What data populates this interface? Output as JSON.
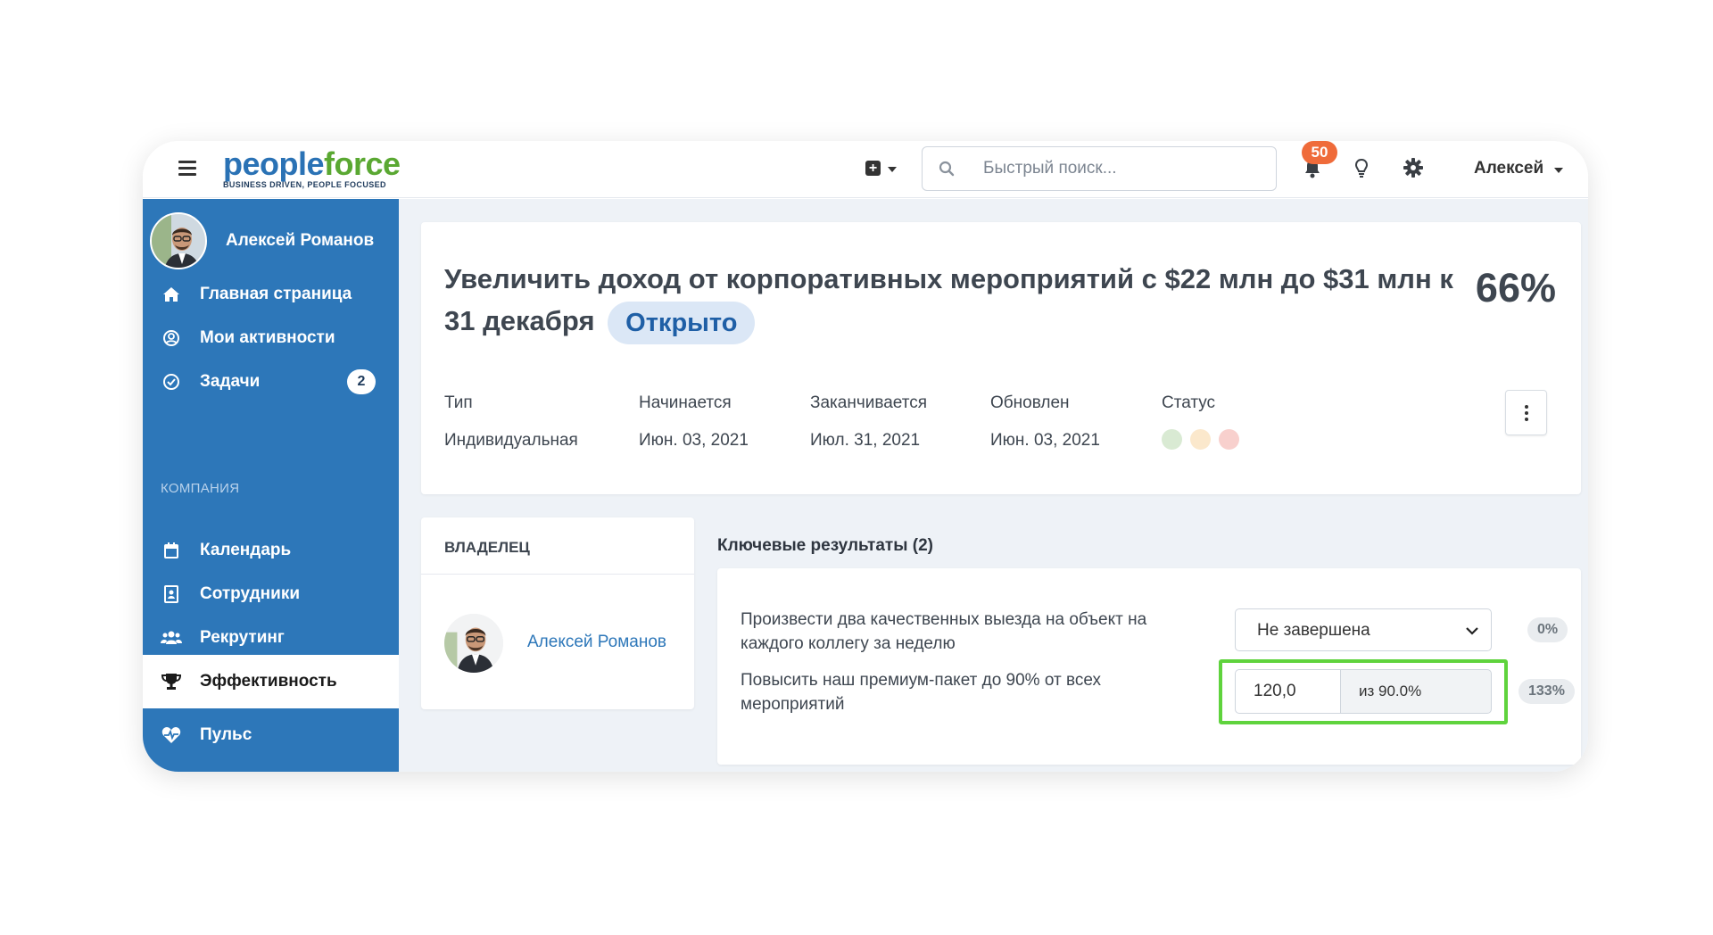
{
  "header": {
    "logo_people": "people",
    "logo_force": "force",
    "logo_tagline": "BUSINESS DRIVEN, PEOPLE FOCUSED",
    "search_placeholder": "Быстрый поиск...",
    "notification_count": "50",
    "user_menu_label": "Алексей",
    "icons": [
      "menu-icon",
      "add-icon",
      "search-icon",
      "bell-icon",
      "lightbulb-icon",
      "gear-icon",
      "chevron-down-icon"
    ]
  },
  "sidebar": {
    "profile_name": "Алексей Романов",
    "items_top": [
      {
        "label": "Главная страница",
        "icon": "home-icon"
      },
      {
        "label": "Мои активности",
        "icon": "user-circle-icon"
      },
      {
        "label": "Задачи",
        "icon": "check-circle-icon",
        "badge": "2"
      }
    ],
    "section_label": "КОМПАНИЯ",
    "items_company": [
      {
        "label": "Календарь",
        "icon": "calendar-icon"
      },
      {
        "label": "Сотрудники",
        "icon": "id-card-icon"
      },
      {
        "label": "Рекрутинг",
        "icon": "users-icon"
      },
      {
        "label": "Эффективность",
        "icon": "trophy-icon",
        "active": true
      },
      {
        "label": "Пульс",
        "icon": "heartbeat-icon"
      }
    ]
  },
  "objective": {
    "title": "Увеличить доход от корпоративных мероприятий с $22 млн до $31 млн к 31 декабря",
    "status": "Открыто",
    "percent": "66%",
    "meta": [
      {
        "label": "Тип",
        "value": "Индивидуальная"
      },
      {
        "label": "Начинается",
        "value": "Июн. 03, 2021"
      },
      {
        "label": "Заканчивается",
        "value": "Июл. 31, 2021"
      },
      {
        "label": "Обновлен",
        "value": "Июн. 03, 2021"
      }
    ],
    "status_label": "Статус",
    "status_colors": [
      "#d9ead3",
      "#fbe8cc",
      "#f8d0cd"
    ]
  },
  "owner": {
    "heading": "ВЛАДЕЛЕЦ",
    "name": "Алексей Романов"
  },
  "key_results": {
    "title": "Ключевые результаты (2)",
    "items": [
      {
        "text": "Произвести два качественных выезда на объект на каждого коллегу за неделю",
        "select_value": "Не завершена",
        "percent": "0%"
      },
      {
        "text": "Повысить наш премиум-пакет до 90% от всех мероприятий",
        "input_value": "120,0",
        "input_suffix": "из 90.0%",
        "percent": "133%"
      }
    ]
  },
  "colors": {
    "sidebar": "#2d77b9",
    "accent_green": "#5fd33d",
    "badge_orange": "#ef6b3a"
  }
}
